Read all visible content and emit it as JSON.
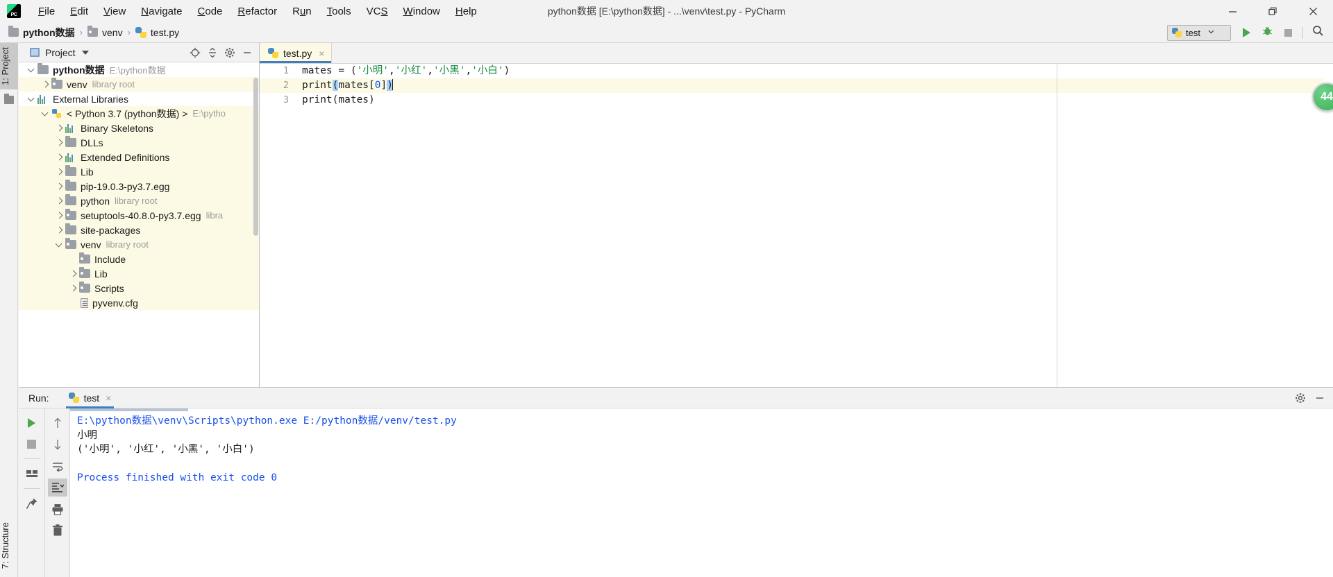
{
  "window": {
    "title": "python数据 [E:\\python数据] - ...\\venv\\test.py - PyCharm",
    "logo_text": "PC",
    "controls": {
      "minimize": "minimize-icon",
      "restore": "restore-icon",
      "close": "close-icon"
    }
  },
  "menubar": {
    "items": [
      {
        "label": "File"
      },
      {
        "label": "Edit"
      },
      {
        "label": "View"
      },
      {
        "label": "Navigate"
      },
      {
        "label": "Code"
      },
      {
        "label": "Refactor"
      },
      {
        "label": "Run"
      },
      {
        "label": "Tools"
      },
      {
        "label": "VCS"
      },
      {
        "label": "Window"
      },
      {
        "label": "Help"
      }
    ]
  },
  "navbar": {
    "breadcrumbs": [
      {
        "label": "python数据",
        "icon": "folder-icon"
      },
      {
        "label": "venv",
        "icon": "folder-library-icon"
      },
      {
        "label": "test.py",
        "icon": "python-file-icon"
      }
    ],
    "separator": "›",
    "run_config": {
      "label": "test",
      "icon": "python-icon",
      "caret": "chevron-down-icon"
    },
    "buttons": [
      {
        "name": "run-button",
        "icon": "run-triangle-icon"
      },
      {
        "name": "debug-button",
        "icon": "bug-icon"
      },
      {
        "name": "stop-button",
        "icon": "stop-square-icon"
      },
      {
        "name": "search-everywhere-button",
        "icon": "search-icon"
      }
    ]
  },
  "left_rail": {
    "top_tab": "1: Project",
    "bottom_tab": "7: Structure"
  },
  "project_panel": {
    "title": "Project",
    "caret": "chevron-down-icon",
    "tools": [
      {
        "name": "locate-file-button",
        "icon": "target-icon"
      },
      {
        "name": "collapse-all-button",
        "icon": "collapse-all-icon"
      },
      {
        "name": "settings-button",
        "icon": "gear-icon"
      },
      {
        "name": "hide-panel-button",
        "icon": "minimize-icon"
      }
    ],
    "tree": [
      {
        "label": "python数据",
        "path": "E:\\python数据",
        "indent": 0,
        "arrow": "down",
        "icon": "folder",
        "bold": true,
        "hl": false
      },
      {
        "label": "venv",
        "path": "library root",
        "indent": 1,
        "arrow": "right",
        "icon": "folder-lib",
        "bold": false,
        "hl": true
      },
      {
        "label": "External Libraries",
        "path": "",
        "indent": 0,
        "arrow": "down",
        "icon": "bars",
        "bold": false,
        "hl": false
      },
      {
        "label": "< Python 3.7 (python数据) >",
        "path": "E:\\pytho",
        "indent": 1,
        "arrow": "down",
        "icon": "python",
        "bold": false,
        "hl": true
      },
      {
        "label": "Binary Skeletons",
        "path": "",
        "indent": 2,
        "arrow": "right",
        "icon": "bars",
        "bold": false,
        "hl": true
      },
      {
        "label": "DLLs",
        "path": "",
        "indent": 2,
        "arrow": "right",
        "icon": "folder",
        "bold": false,
        "hl": true
      },
      {
        "label": "Extended Definitions",
        "path": "",
        "indent": 2,
        "arrow": "right",
        "icon": "bars",
        "bold": false,
        "hl": true
      },
      {
        "label": "Lib",
        "path": "",
        "indent": 2,
        "arrow": "right",
        "icon": "folder",
        "bold": false,
        "hl": true
      },
      {
        "label": "pip-19.0.3-py3.7.egg",
        "path": "",
        "indent": 2,
        "arrow": "right",
        "icon": "folder",
        "bold": false,
        "hl": true
      },
      {
        "label": "python",
        "path": "library root",
        "indent": 2,
        "arrow": "right",
        "icon": "folder",
        "bold": false,
        "hl": true
      },
      {
        "label": "setuptools-40.8.0-py3.7.egg",
        "path": "libra",
        "indent": 2,
        "arrow": "right",
        "icon": "folder-lib",
        "bold": false,
        "hl": true
      },
      {
        "label": "site-packages",
        "path": "",
        "indent": 2,
        "arrow": "right",
        "icon": "folder",
        "bold": false,
        "hl": true
      },
      {
        "label": "venv",
        "path": "library root",
        "indent": 2,
        "arrow": "down",
        "icon": "folder-lib",
        "bold": false,
        "hl": true
      },
      {
        "label": "Include",
        "path": "",
        "indent": 3,
        "arrow": "none",
        "icon": "folder-lib",
        "bold": false,
        "hl": true
      },
      {
        "label": "Lib",
        "path": "",
        "indent": 3,
        "arrow": "right",
        "icon": "folder-lib",
        "bold": false,
        "hl": true
      },
      {
        "label": "Scripts",
        "path": "",
        "indent": 3,
        "arrow": "right",
        "icon": "folder-lib",
        "bold": false,
        "hl": true
      },
      {
        "label": "pyvenv.cfg",
        "path": "",
        "indent": 3,
        "arrow": "none",
        "icon": "cfgfile",
        "bold": false,
        "hl": true
      }
    ]
  },
  "editor": {
    "tab": {
      "name": "test.py",
      "icon": "python-file-icon",
      "close": "×"
    },
    "line_numbers": [
      "1",
      "2",
      "3"
    ],
    "code": [
      {
        "n": "1",
        "highlight": false,
        "tokens": [
          {
            "t": "mates = (",
            "c": "plain"
          },
          {
            "t": "'小明'",
            "c": "string"
          },
          {
            "t": ",",
            "c": "plain"
          },
          {
            "t": "'小红'",
            "c": "string"
          },
          {
            "t": ",",
            "c": "plain"
          },
          {
            "t": "'小黑'",
            "c": "string"
          },
          {
            "t": ",",
            "c": "plain"
          },
          {
            "t": "'小白'",
            "c": "string"
          },
          {
            "t": ")",
            "c": "plain"
          }
        ]
      },
      {
        "n": "2",
        "highlight": true,
        "tokens": [
          {
            "t": "print",
            "c": "plain"
          },
          {
            "t": "(",
            "c": "paren-match"
          },
          {
            "t": "mates[",
            "c": "plain"
          },
          {
            "t": "0",
            "c": "number"
          },
          {
            "t": "]",
            "c": "plain"
          },
          {
            "t": ")",
            "c": "paren-match"
          }
        ],
        "caret": true
      },
      {
        "n": "3",
        "highlight": false,
        "tokens": [
          {
            "t": "print(mates)",
            "c": "plain"
          }
        ]
      }
    ],
    "notification_badge": "44"
  },
  "run_panel": {
    "label": "Run:",
    "tab": {
      "name": "test",
      "icon": "python-icon",
      "close": "×"
    },
    "header_tools": [
      {
        "name": "settings-button",
        "icon": "gear-icon"
      },
      {
        "name": "hide-panel-button",
        "icon": "minimize-icon"
      }
    ],
    "left_tools": [
      {
        "name": "rerun-button",
        "icon": "run-triangle-icon"
      },
      {
        "name": "stop-button",
        "icon": "stop-square-icon"
      },
      {
        "name": "layout-button",
        "icon": "layout-icon"
      },
      {
        "name": "pin-button",
        "icon": "pin-icon"
      }
    ],
    "console_tools": [
      {
        "name": "up-button",
        "icon": "arrow-up-icon"
      },
      {
        "name": "down-button",
        "icon": "arrow-down-icon"
      },
      {
        "name": "soft-wrap-button",
        "icon": "wrap-icon"
      },
      {
        "name": "scroll-to-end-button",
        "icon": "scroll-end-icon",
        "selected": true
      },
      {
        "name": "print-button",
        "icon": "printer-icon"
      },
      {
        "name": "clear-all-button",
        "icon": "trash-icon"
      }
    ],
    "console_lines": [
      {
        "text": "E:\\python数据\\venv\\Scripts\\python.exe E:/python数据/venv/test.py",
        "color": "blue"
      },
      {
        "text": "小明",
        "color": "black"
      },
      {
        "text": "('小明', '小红', '小黑', '小白')",
        "color": "black"
      },
      {
        "text": "",
        "color": "black"
      },
      {
        "text": "Process finished with exit code 0",
        "color": "blue"
      }
    ]
  },
  "colors": {
    "accent_blue": "#3e7fc1",
    "string_green": "#148a3e",
    "number_blue": "#1750eb",
    "console_blue": "#1750eb",
    "highlight_yellow": "#fcfae4",
    "run_green": "#4ca64c"
  }
}
